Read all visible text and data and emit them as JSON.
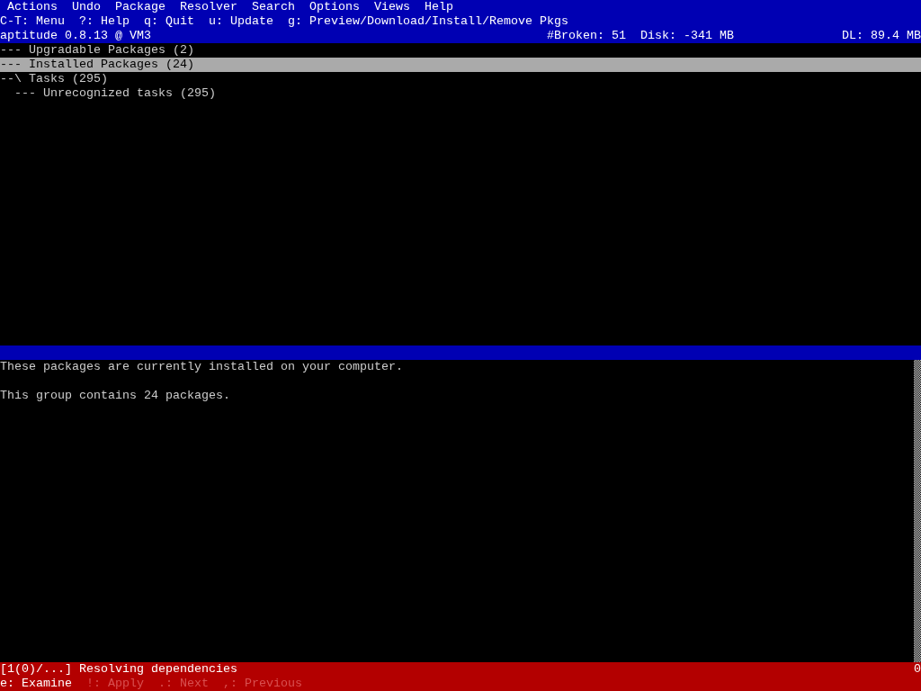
{
  "menu": [
    "Actions",
    "Undo",
    "Package",
    "Resolver",
    "Search",
    "Options",
    "Views",
    "Help"
  ],
  "key_hints": [
    "C-T: Menu",
    "?: Help",
    "q: Quit",
    "u: Update",
    "g: Preview/Download/Install/Remove Pkgs"
  ],
  "status": {
    "title": "aptitude 0.8.13 @ VM3",
    "broken": "#Broken: 51",
    "disk": "Disk: -341 MB",
    "download": "DL: 89.4 MB"
  },
  "tree": [
    {
      "prefix": "---",
      "label": "Upgradable Packages (2)",
      "selected": false
    },
    {
      "prefix": "---",
      "label": "Installed Packages (24)",
      "selected": true
    },
    {
      "prefix": "--\\",
      "label": "Tasks (295)",
      "selected": false,
      "children": [
        {
          "prefix": "---",
          "label": "Unrecognized tasks (295)",
          "selected": false
        }
      ]
    }
  ],
  "description": [
    "These packages are currently installed on your computer.",
    "This group contains 24 packages."
  ],
  "resolver": {
    "message": "[1(0)/...] Resolving dependencies",
    "count": "0",
    "actions": [
      {
        "label": "e: Examine",
        "disabled": false
      },
      {
        "label": "!: Apply",
        "disabled": true
      },
      {
        "label": ".: Next",
        "disabled": true
      },
      {
        "label": ",: Previous",
        "disabled": true
      }
    ]
  }
}
